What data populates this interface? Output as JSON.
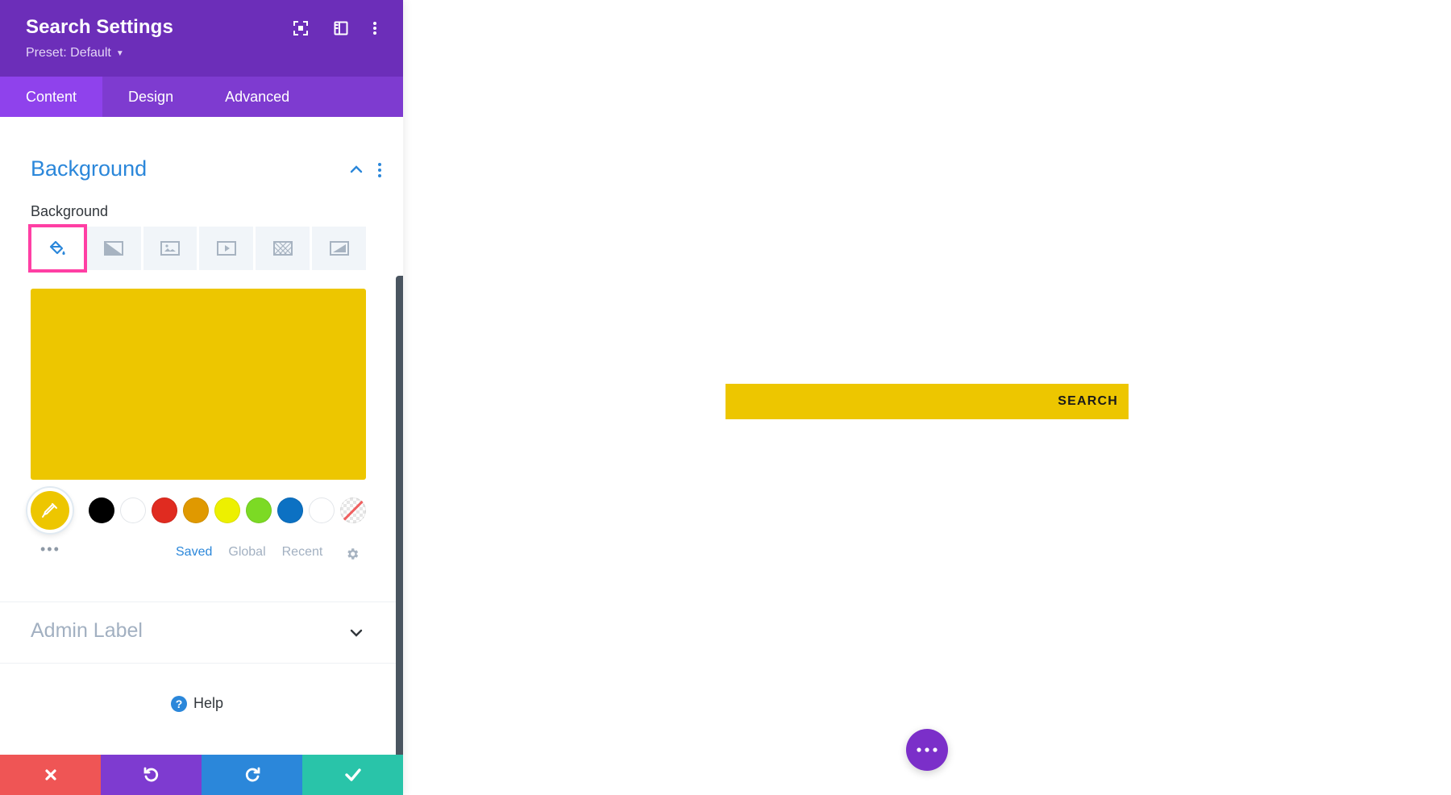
{
  "panel": {
    "title": "Search Settings",
    "preset": "Preset: Default",
    "tabs": [
      {
        "label": "Content",
        "active": true
      },
      {
        "label": "Design",
        "active": false
      },
      {
        "label": "Advanced",
        "active": false
      }
    ]
  },
  "background_section": {
    "title": "Background",
    "field_label": "Background",
    "bg_tabs": [
      "paint-bucket-icon",
      "gradient-icon",
      "image-icon",
      "video-icon",
      "pattern-icon",
      "mask-icon"
    ],
    "selected_color": "#edc600",
    "swatches": [
      "#000000",
      "#ffffff",
      "#e02b20",
      "#e09900",
      "#edf000",
      "#7cda24",
      "#0c71c3",
      "#ffffff"
    ],
    "palette_tabs": {
      "saved": "Saved",
      "global": "Global",
      "recent": "Recent"
    }
  },
  "admin_label": {
    "title": "Admin Label"
  },
  "help": {
    "label": "Help"
  },
  "footer": {
    "cancel_color": "#ef5555",
    "undo_color": "#7e3bd0",
    "redo_color": "#2b87da",
    "save_color": "#29c4a9"
  },
  "canvas": {
    "search_button": "SEARCH",
    "search_bg": "#edc600"
  },
  "colors": {
    "header": "#6c2eb9",
    "tabs_bar": "#7e3bd0",
    "accent": "#2b87da",
    "highlight": "#ff3fa4",
    "fab": "#7b2fc9"
  }
}
